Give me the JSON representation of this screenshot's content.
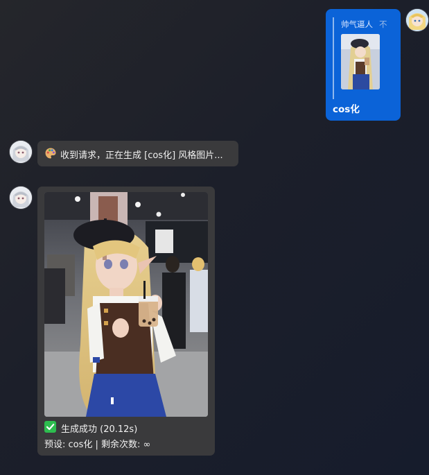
{
  "outgoing": {
    "reply": {
      "sender_name": "帅气逼人",
      "more_hint": "不",
      "thumbnail": "cosplay-photo-thumbnail"
    },
    "text": "cos化"
  },
  "bot_status": {
    "icon": "palette-icon",
    "text": "收到请求，正在生成 [cos化] 风格图片..."
  },
  "bot_result": {
    "image": "generated-cosplay-photo",
    "status_icon": "check-mark-icon",
    "status_text": "生成成功 (20.12s)",
    "info_text": "预设: cos化 | 剩余次数: ∞"
  },
  "colors": {
    "user_bubble": "#0b63d8",
    "bot_bubble": "#3a3a3c",
    "success": "#2dbd4f"
  }
}
